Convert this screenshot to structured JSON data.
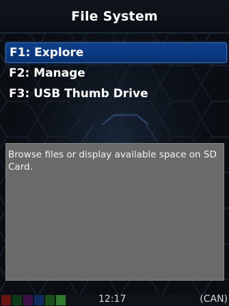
{
  "header": {
    "title": "File System"
  },
  "menu": {
    "items": [
      {
        "label": "F1: Explore",
        "selected": true
      },
      {
        "label": "F2: Manage",
        "selected": false
      },
      {
        "label": "F3: USB Thumb Drive",
        "selected": false
      }
    ]
  },
  "description": {
    "text": "Browse files or display available space on SD Card."
  },
  "status": {
    "time": "12:17",
    "mode": "(CAN)",
    "indicators": [
      {
        "name": "indicator-1",
        "color": "#6b1414"
      },
      {
        "name": "indicator-2",
        "color": "#0e3a18"
      },
      {
        "name": "indicator-3",
        "color": "#3a1246"
      },
      {
        "name": "indicator-4",
        "color": "#0f2a5e"
      },
      {
        "name": "indicator-5",
        "color": "#1a4d1a"
      },
      {
        "name": "indicator-6",
        "color": "#2e7a2e"
      }
    ]
  },
  "colors": {
    "accent": "#0b3a86",
    "panel": "#6a6a6a",
    "background": "#0a0d12"
  }
}
